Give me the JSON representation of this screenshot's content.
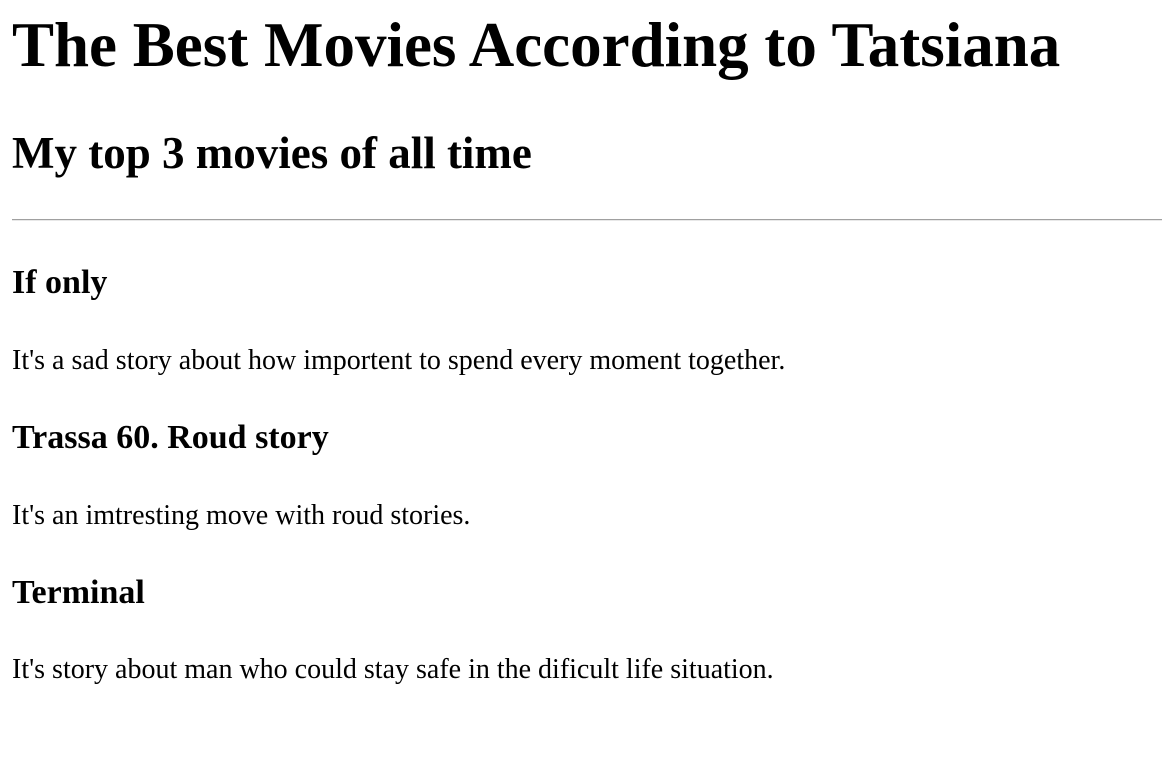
{
  "page": {
    "title": "The Best Movies According to Tatsiana",
    "subtitle": "My top 3 movies of all time"
  },
  "movies": [
    {
      "title": "If only",
      "description": "It's a sad story about how importent to spend every moment together."
    },
    {
      "title": "Trassa 60. Roud story",
      "description": "It's an imtresting move with roud stories."
    },
    {
      "title": "Terminal",
      "description": "It's story about man who could stay safe in the dificult life situation."
    }
  ]
}
